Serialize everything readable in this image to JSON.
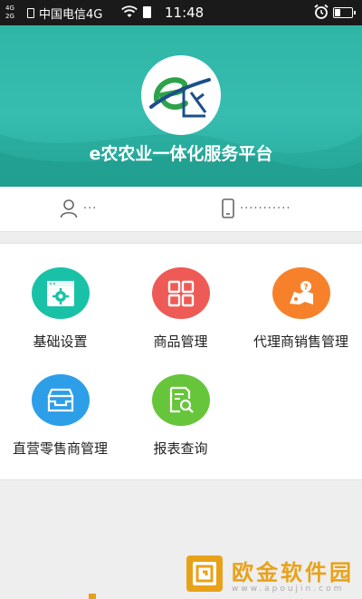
{
  "status_bar": {
    "net_top": "4G",
    "net_bottom": "2G",
    "carrier": "中国电信4G",
    "time": "11:48",
    "icons": [
      "sim-icon",
      "wifi-icon",
      "charge-icon",
      "alarm-icon",
      "battery-icon"
    ]
  },
  "header": {
    "logo_text": "e农",
    "title": "e农农业一体化服务平台",
    "colors": {
      "primary": "#2fb6a6",
      "logo_green": "#2ea24a",
      "logo_blue": "#1b4f8a"
    }
  },
  "account": {
    "user_icon": "user-icon",
    "user_value": "···",
    "phone_icon": "phone-icon",
    "phone_value": "···········"
  },
  "menu": [
    {
      "label": "基础设置",
      "icon": "settings-window-icon",
      "color": "#19c2a7"
    },
    {
      "label": "商品管理",
      "icon": "grid-squares-icon",
      "color": "#ee5a55"
    },
    {
      "label": "代理商销售管理",
      "icon": "map-question-icon",
      "color": "#f7812b"
    },
    {
      "label": "直营零售商管理",
      "icon": "store-box-icon",
      "color": "#2d9ee8"
    },
    {
      "label": "报表查询",
      "icon": "report-search-icon",
      "color": "#67c53b"
    }
  ],
  "watermark": {
    "name": "欧金软件园",
    "url": "www.apoujin.com"
  }
}
